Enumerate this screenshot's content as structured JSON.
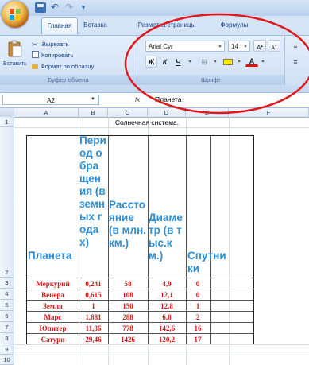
{
  "ribbon": {
    "tabs": [
      "Главная",
      "Вставка",
      "Разметка страницы",
      "Формулы"
    ],
    "clipboard": {
      "paste_label": "Вставить",
      "cut_label": "Вырезать",
      "copy_label": "Копировать",
      "format_painter_label": "Формат по образцу",
      "group_label": "Буфер обмена"
    },
    "font": {
      "name": "Arial Cyr",
      "size": "14",
      "group_label": "Шрифт",
      "bold": "Ж",
      "italic": "К",
      "underline": "Ч"
    }
  },
  "formula_bar": {
    "cell_ref": "A2",
    "fx": "fx",
    "value": "Планета"
  },
  "sheet": {
    "columns": [
      "A",
      "B",
      "C",
      "D",
      "E",
      "F"
    ],
    "rows": [
      "1",
      "2",
      "3",
      "4",
      "5",
      "6",
      "7",
      "8",
      "9",
      "10"
    ],
    "title": "Солнечная система.",
    "headers": [
      "Планета",
      "Период обращения (в земных годах)",
      "Расстояние (в млн.км.)",
      "Диаметр (в тыс.км.)",
      "Спутники"
    ],
    "data": [
      [
        "Меркурий",
        "0,241",
        "58",
        "4,9",
        "0"
      ],
      [
        "Венера",
        "0,615",
        "108",
        "12,1",
        "0"
      ],
      [
        "Земля",
        "1",
        "150",
        "12,8",
        "1"
      ],
      [
        "Марс",
        "1,881",
        "288",
        "6,8",
        "2"
      ],
      [
        "Юпитер",
        "11,86",
        "778",
        "142,6",
        "16"
      ],
      [
        "Сатурн",
        "29,46",
        "1426",
        "120,2",
        "17"
      ]
    ]
  },
  "colors": {
    "header_text": "#2e8fd6",
    "data_text": "#d01818",
    "highlight": "#e0181b"
  }
}
